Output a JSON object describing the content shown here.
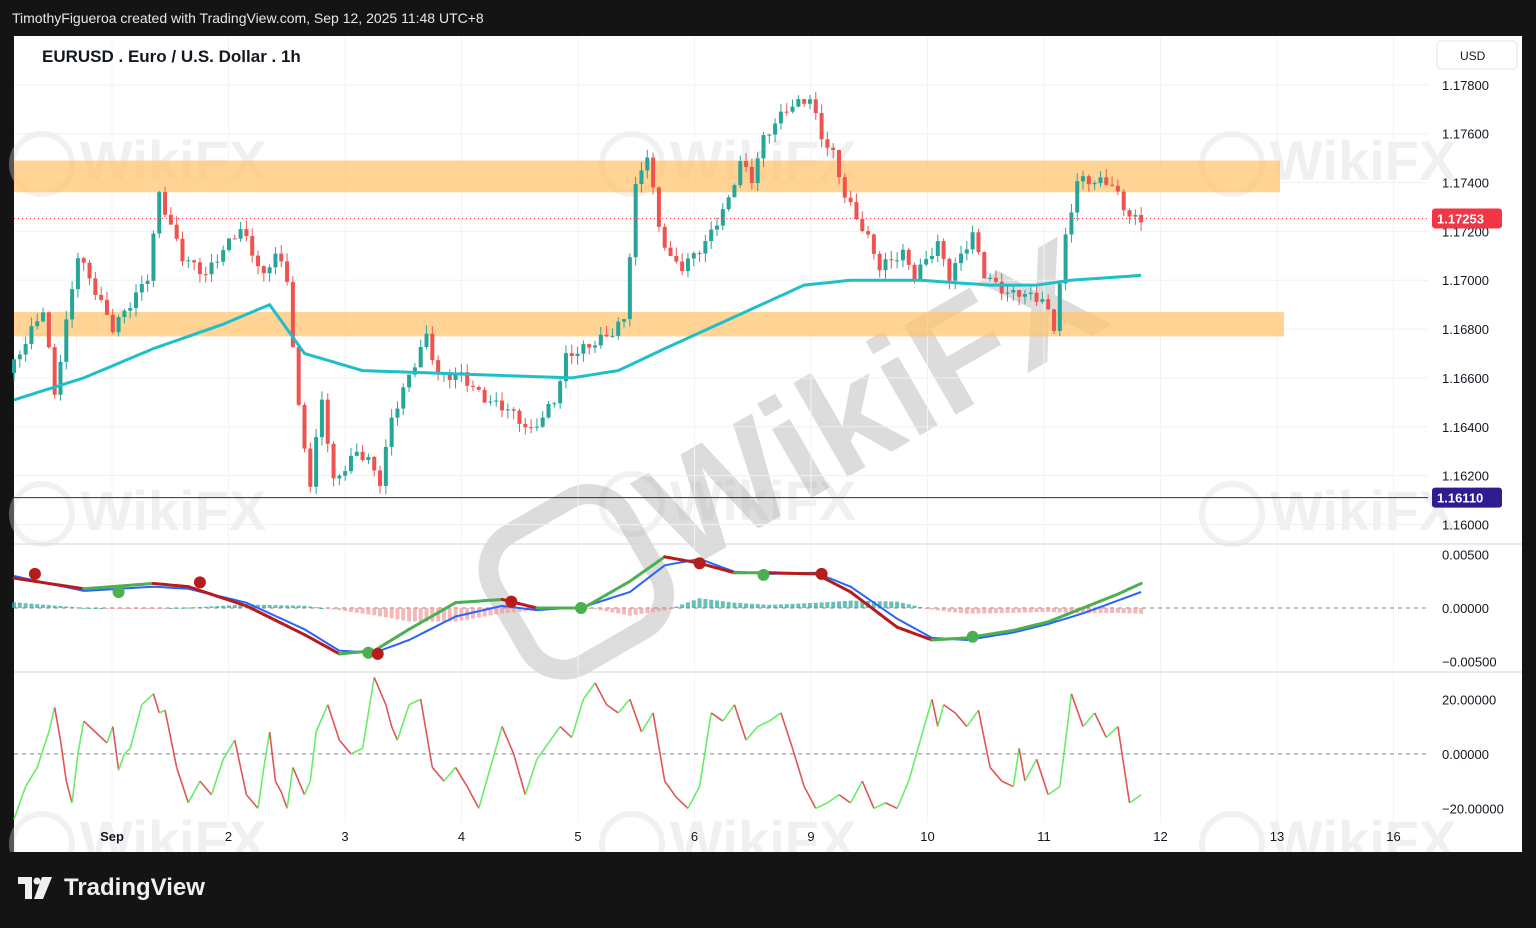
{
  "header": {
    "attribution": "TimothyFigueroa created with TradingView.com, Sep 12, 2025 11:48 UTC+8"
  },
  "chart_title": "EURUSD . Euro / U.S. Dollar . 1h",
  "currency_button": "USD",
  "footer": {
    "brand": "TradingView"
  },
  "watermark": "WikiFX",
  "colors": {
    "bull": "#26a69a",
    "bear": "#ef5350",
    "zone": "#ffc46b",
    "ma": "#1fbfc9",
    "macd_line": "#2962ff",
    "signal_up": "#4caf50",
    "signal_down": "#b71c1c",
    "osc_up": "#66ee66",
    "osc_down": "#e05555",
    "last_price_tag": "#f23645",
    "level_tag": "#311b92"
  },
  "chart_data": {
    "type": "candlestick",
    "symbol": "EURUSD",
    "timeframe": "1h",
    "x_ticks": [
      "Sep",
      "2",
      "3",
      "4",
      "5",
      "6",
      "9",
      "10",
      "11",
      "12",
      "13",
      "16"
    ],
    "price_axis": {
      "ticks": [
        "1.17800",
        "1.17600",
        "1.17400",
        "1.17200",
        "1.17000",
        "1.16800",
        "1.16600",
        "1.16400",
        "1.16200",
        "1.16000"
      ],
      "range": [
        1.1592,
        1.18
      ]
    },
    "last_price": {
      "label": "1.17253",
      "value": 1.17253
    },
    "horizontal_level": {
      "label": "1.16110",
      "value": 1.1611
    },
    "zones": [
      {
        "from": 1.1736,
        "to": 1.1749
      },
      {
        "from": 1.1677,
        "to": 1.1687
      }
    ],
    "price_path": [
      [
        0,
        1.1662
      ],
      [
        3,
        1.1685
      ],
      [
        4,
        1.165
      ],
      [
        6,
        1.1708
      ],
      [
        9,
        1.1682
      ],
      [
        12,
        1.1705
      ],
      [
        13,
        1.1738
      ],
      [
        15,
        1.171
      ],
      [
        17,
        1.17
      ],
      [
        20,
        1.1718
      ],
      [
        22,
        1.17
      ],
      [
        23,
        1.1712
      ],
      [
        24,
        1.1702
      ],
      [
        25,
        1.165
      ],
      [
        26,
        1.162
      ],
      [
        27,
        1.1655
      ],
      [
        28,
        1.162
      ],
      [
        30,
        1.163
      ],
      [
        31,
        1.1625
      ],
      [
        32,
        1.1615
      ],
      [
        33,
        1.164
      ],
      [
        35,
        1.1663
      ],
      [
        36,
        1.1675
      ],
      [
        37,
        1.166
      ],
      [
        39,
        1.1663
      ],
      [
        41,
        1.1655
      ],
      [
        43,
        1.165
      ],
      [
        45,
        1.1638
      ],
      [
        47,
        1.1648
      ],
      [
        48,
        1.1665
      ],
      [
        50,
        1.167
      ],
      [
        52,
        1.1678
      ],
      [
        53,
        1.1685
      ],
      [
        54,
        1.174
      ],
      [
        55,
        1.1755
      ],
      [
        56,
        1.1725
      ],
      [
        57,
        1.1712
      ],
      [
        58,
        1.1708
      ],
      [
        60,
        1.1715
      ],
      [
        62,
        1.173
      ],
      [
        63,
        1.1745
      ],
      [
        64,
        1.1738
      ],
      [
        65,
        1.1755
      ],
      [
        67,
        1.177
      ],
      [
        69,
        1.1777
      ],
      [
        70,
        1.1762
      ],
      [
        71,
        1.1755
      ],
      [
        72,
        1.1738
      ],
      [
        74,
        1.1718
      ],
      [
        75,
        1.1705
      ],
      [
        77,
        1.1708
      ],
      [
        78,
        1.1698
      ],
      [
        80,
        1.1712
      ],
      [
        81,
        1.17
      ],
      [
        83,
        1.172
      ],
      [
        84,
        1.1705
      ],
      [
        86,
        1.1698
      ],
      [
        87,
        1.1698
      ],
      [
        89,
        1.1693
      ],
      [
        90,
        1.168
      ],
      [
        91,
        1.1715
      ],
      [
        92,
        1.1738
      ],
      [
        93,
        1.1737
      ],
      [
        95,
        1.1737
      ],
      [
        96,
        1.1728
      ],
      [
        97,
        1.1725
      ]
    ],
    "moving_average": [
      [
        0,
        1.1651
      ],
      [
        6,
        1.166
      ],
      [
        12,
        1.1672
      ],
      [
        18,
        1.1682
      ],
      [
        22,
        1.169
      ],
      [
        25,
        1.167
      ],
      [
        30,
        1.1663
      ],
      [
        36,
        1.1662
      ],
      [
        42,
        1.1661
      ],
      [
        48,
        1.166
      ],
      [
        52,
        1.1663
      ],
      [
        56,
        1.1672
      ],
      [
        62,
        1.1685
      ],
      [
        68,
        1.1698
      ],
      [
        72,
        1.17
      ],
      [
        78,
        1.17
      ],
      [
        84,
        1.1698
      ],
      [
        88,
        1.1698
      ],
      [
        91,
        1.17
      ],
      [
        97,
        1.1702
      ]
    ],
    "macd": {
      "range": [
        -0.006,
        0.006
      ],
      "ticks": [
        "0.00500",
        "0.00000",
        "−0.00500"
      ],
      "macd_line": [
        [
          0,
          0.003
        ],
        [
          6,
          0.0016
        ],
        [
          12,
          0.002
        ],
        [
          15,
          0.0018
        ],
        [
          20,
          0.0005
        ],
        [
          25,
          -0.002
        ],
        [
          28,
          -0.004
        ],
        [
          31,
          -0.0042
        ],
        [
          34,
          -0.003
        ],
        [
          38,
          -0.0008
        ],
        [
          42,
          0.0002
        ],
        [
          45,
          -0.0002
        ],
        [
          49,
          0.0001
        ],
        [
          53,
          0.0015
        ],
        [
          56,
          0.004
        ],
        [
          59,
          0.0046
        ],
        [
          62,
          0.0034
        ],
        [
          65,
          0.0032
        ],
        [
          69,
          0.0033
        ],
        [
          72,
          0.002
        ],
        [
          76,
          -0.001
        ],
        [
          79,
          -0.0028
        ],
        [
          82,
          -0.003
        ],
        [
          86,
          -0.0023
        ],
        [
          89,
          -0.0015
        ],
        [
          92,
          -0.0005
        ],
        [
          95,
          0.0007
        ],
        [
          97,
          0.0015
        ]
      ],
      "signal_line": [
        [
          0,
          0.0028
        ],
        [
          6,
          0.0018
        ],
        [
          12,
          0.0023
        ],
        [
          15,
          0.002
        ],
        [
          20,
          0.0002
        ],
        [
          25,
          -0.0025
        ],
        [
          28,
          -0.0043
        ],
        [
          31,
          -0.004
        ],
        [
          34,
          -0.002
        ],
        [
          38,
          0.0005
        ],
        [
          42,
          0.0008
        ],
        [
          45,
          0.0
        ],
        [
          49,
          0.0
        ],
        [
          53,
          0.0025
        ],
        [
          56,
          0.0048
        ],
        [
          59,
          0.0042
        ],
        [
          62,
          0.0033
        ],
        [
          65,
          0.0033
        ],
        [
          69,
          0.0032
        ],
        [
          72,
          0.0015
        ],
        [
          76,
          -0.0018
        ],
        [
          79,
          -0.003
        ],
        [
          82,
          -0.0028
        ],
        [
          86,
          -0.0021
        ],
        [
          89,
          -0.0013
        ],
        [
          92,
          0.0
        ],
        [
          95,
          0.0013
        ],
        [
          97,
          0.0023
        ]
      ],
      "cross_points": [
        {
          "t": 1.8,
          "v": 0.0032,
          "dir": "down"
        },
        {
          "t": 9,
          "v": 0.0015,
          "dir": "up"
        },
        {
          "t": 16,
          "v": 0.0024,
          "dir": "down"
        },
        {
          "t": 30.5,
          "v": -0.0042,
          "dir": "up"
        },
        {
          "t": 31.3,
          "v": -0.0043,
          "dir": "down"
        },
        {
          "t": 42.8,
          "v": 0.0006,
          "dir": "down"
        },
        {
          "t": 48.8,
          "v": 0.0,
          "dir": "up"
        },
        {
          "t": 59,
          "v": 0.0042,
          "dir": "down"
        },
        {
          "t": 64.5,
          "v": 0.0031,
          "dir": "up"
        },
        {
          "t": 69.5,
          "v": 0.0032,
          "dir": "down"
        },
        {
          "t": 82.5,
          "v": -0.0027,
          "dir": "up"
        }
      ]
    },
    "oscillator": {
      "range": [
        -25,
        30
      ],
      "ticks": [
        "20.00000",
        "0.00000",
        "−20.00000"
      ],
      "points": [
        [
          0,
          -24
        ],
        [
          1,
          -12
        ],
        [
          2,
          -5
        ],
        [
          3,
          8
        ],
        [
          3.5,
          17
        ],
        [
          4,
          5
        ],
        [
          4.5,
          -10
        ],
        [
          5,
          -18
        ],
        [
          5.5,
          0
        ],
        [
          6,
          12
        ],
        [
          7,
          8
        ],
        [
          8,
          4
        ],
        [
          8.5,
          10
        ],
        [
          9,
          -6
        ],
        [
          9.5,
          0
        ],
        [
          10,
          2
        ],
        [
          11,
          18
        ],
        [
          12,
          22
        ],
        [
          12.5,
          15
        ],
        [
          13,
          16
        ],
        [
          14,
          -5
        ],
        [
          15,
          -18
        ],
        [
          16,
          -10
        ],
        [
          17,
          -15
        ],
        [
          18,
          -2
        ],
        [
          19,
          5
        ],
        [
          20,
          -15
        ],
        [
          21,
          -20
        ],
        [
          21.5,
          -5
        ],
        [
          22,
          8
        ],
        [
          22.5,
          -10
        ],
        [
          23,
          -14
        ],
        [
          23.5,
          -20
        ],
        [
          24,
          -5
        ],
        [
          25,
          -15
        ],
        [
          25.5,
          -10
        ],
        [
          26,
          8
        ],
        [
          27,
          18
        ],
        [
          28,
          5
        ],
        [
          29,
          0
        ],
        [
          30,
          2
        ],
        [
          31,
          28
        ],
        [
          32,
          18
        ],
        [
          32.5,
          10
        ],
        [
          33,
          5
        ],
        [
          34,
          18
        ],
        [
          35,
          20
        ],
        [
          36,
          -5
        ],
        [
          37,
          -10
        ],
        [
          38,
          -5
        ],
        [
          39,
          -12
        ],
        [
          40,
          -20
        ],
        [
          41,
          -5
        ],
        [
          42,
          10
        ],
        [
          43,
          0
        ],
        [
          44,
          -15
        ],
        [
          45,
          -2
        ],
        [
          46,
          4
        ],
        [
          47,
          10
        ],
        [
          48,
          6
        ],
        [
          49,
          20
        ],
        [
          50,
          26
        ],
        [
          51,
          18
        ],
        [
          52,
          15
        ],
        [
          53,
          20
        ],
        [
          54,
          8
        ],
        [
          55,
          15
        ],
        [
          56,
          -10
        ],
        [
          57,
          -16
        ],
        [
          58,
          -20
        ],
        [
          59,
          -12
        ],
        [
          60,
          15
        ],
        [
          61,
          12
        ],
        [
          62,
          18
        ],
        [
          63,
          5
        ],
        [
          64,
          10
        ],
        [
          65,
          12
        ],
        [
          66,
          15
        ],
        [
          67,
          2
        ],
        [
          68,
          -12
        ],
        [
          69,
          -20
        ],
        [
          70,
          -18
        ],
        [
          71,
          -15
        ],
        [
          72,
          -18
        ],
        [
          73,
          -10
        ],
        [
          74,
          -20
        ],
        [
          75,
          -18
        ],
        [
          76,
          -20
        ],
        [
          77,
          -10
        ],
        [
          78,
          5
        ],
        [
          79,
          20
        ],
        [
          79.5,
          10
        ],
        [
          80,
          18
        ],
        [
          81,
          15
        ],
        [
          82,
          10
        ],
        [
          83,
          16
        ],
        [
          84,
          -5
        ],
        [
          85,
          -10
        ],
        [
          86,
          -12
        ],
        [
          86.5,
          2
        ],
        [
          87,
          -10
        ],
        [
          88,
          -2
        ],
        [
          89,
          -15
        ],
        [
          90,
          -12
        ],
        [
          91,
          22
        ],
        [
          92,
          10
        ],
        [
          93,
          15
        ],
        [
          94,
          6
        ],
        [
          95,
          10
        ],
        [
          96,
          -18
        ],
        [
          97,
          -15
        ]
      ]
    }
  }
}
